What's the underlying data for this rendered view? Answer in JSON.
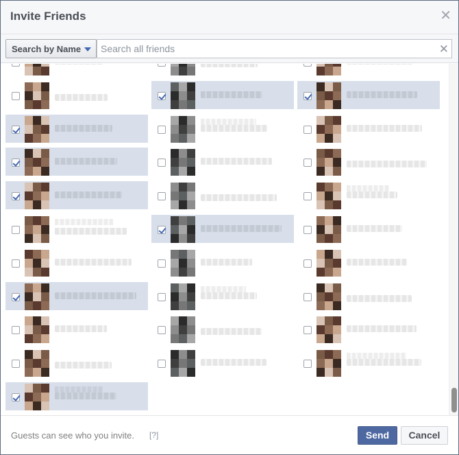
{
  "dialog": {
    "title": "Invite Friends",
    "close_icon": "close-icon"
  },
  "toolbar": {
    "search_by_label": "Search by Name",
    "search_placeholder": "Search all friends",
    "search_value": ""
  },
  "friends": {
    "columns": 3,
    "rows": [
      [
        {
          "checked": false
        },
        {
          "checked": false
        },
        {
          "checked": false
        }
      ],
      [
        {
          "checked": false
        },
        {
          "checked": true
        },
        {
          "checked": true
        }
      ],
      [
        {
          "checked": true
        },
        {
          "checked": false
        },
        {
          "checked": false
        }
      ],
      [
        {
          "checked": true
        },
        {
          "checked": false
        },
        {
          "checked": false
        }
      ],
      [
        {
          "checked": true
        },
        {
          "checked": false
        },
        {
          "checked": false
        }
      ],
      [
        {
          "checked": false
        },
        {
          "checked": true
        },
        {
          "checked": false
        }
      ],
      [
        {
          "checked": false
        },
        {
          "checked": false
        },
        {
          "checked": false
        }
      ],
      [
        {
          "checked": true
        },
        {
          "checked": false
        },
        {
          "checked": false
        }
      ],
      [
        {
          "checked": false
        },
        {
          "checked": false
        },
        {
          "checked": false
        }
      ],
      [
        {
          "checked": false
        },
        {
          "checked": false
        },
        {
          "checked": false
        }
      ],
      [
        {
          "checked": true
        }
      ]
    ]
  },
  "footer": {
    "note": "Guests can see who you invite.",
    "help": "[?]",
    "send_label": "Send",
    "cancel_label": "Cancel"
  },
  "colors": {
    "accent": "#4e69a2",
    "selected_row": "#d8dfea",
    "check": "#4267b2"
  }
}
